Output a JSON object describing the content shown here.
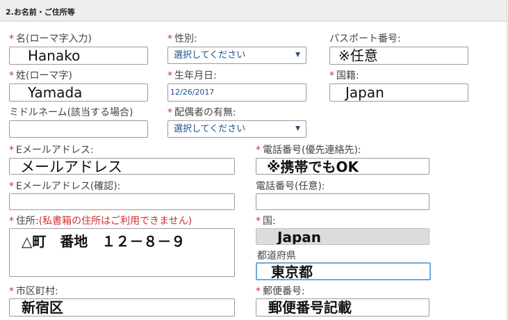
{
  "section": {
    "title": "2.お名前・ご住所等"
  },
  "labels": {
    "given_name": "名(ローマ字入力)",
    "gender": "性別:",
    "passport": "パスポート番号:",
    "family_name": "姓(ローマ字)",
    "birthdate": "生年月日:",
    "nationality": "国籍:",
    "middle_name": "ミドルネーム(該当する場合)",
    "spouse": "配偶者の有無:",
    "email": "Eメールアドレス:",
    "phone": "電話番号(優先連絡先):",
    "email_confirm": "Eメールアドレス(確認):",
    "phone_optional": "電話番号(任意):",
    "address": "住所:",
    "address_note": "(私書箱の住所はご利用できません)",
    "country": "国:",
    "prefecture": "都道府県",
    "city": "市区町村:",
    "postal": "郵便番号:"
  },
  "values": {
    "given_name": "Hanako",
    "passport": "※任意",
    "family_name": "Yamada",
    "birthdate": "12/26/2017",
    "nationality": "Japan",
    "middle_name": "",
    "email": "メールアドレス",
    "phone": "※携帯でもOK",
    "email_confirm": "",
    "phone_optional": "",
    "address": "△町　番地　１２－８－９",
    "country": "Japan",
    "prefecture": "東京都",
    "city": "新宿区",
    "postal": "郵便番号記載"
  },
  "selects": {
    "gender": "選択してください",
    "spouse": "選択してください"
  },
  "required_mark": "*",
  "colors": {
    "required": "#d03030",
    "select_text": "#1a4f8b",
    "disabled_bg": "#dcdcdc",
    "focus_border": "#6fa8dc"
  }
}
